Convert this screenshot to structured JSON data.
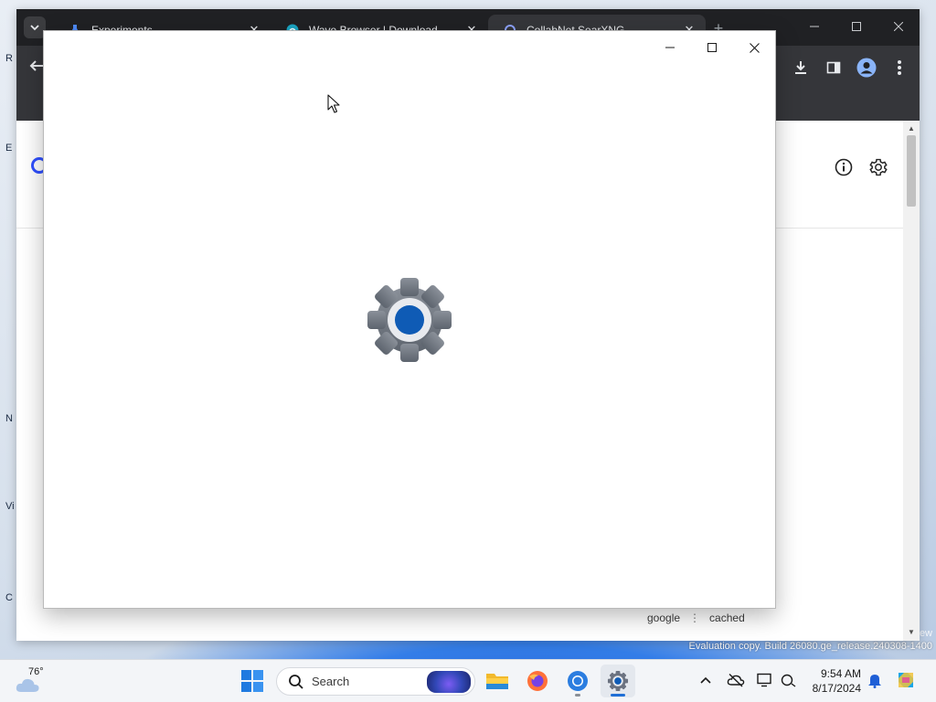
{
  "desktop": {
    "edge_letters": [
      "R",
      "E",
      "N",
      "Vi",
      "C"
    ],
    "watermark": "Evaluation copy. Build 26080.ge_release.240308-1400",
    "watermark_edge": "ew"
  },
  "browser": {
    "tabs": [
      {
        "title": "Experiments",
        "icon": "flask-icon",
        "active": false
      },
      {
        "title": "Wave Browser | Download",
        "icon": "wave-icon",
        "active": false
      },
      {
        "title": "CollabNet SearXNG",
        "icon": "searxng-icon",
        "active": true
      }
    ],
    "close_glyph": "✕",
    "new_tab_glyph": "+",
    "page": {
      "footer_links": [
        "google",
        "cached"
      ],
      "footer_separator": "⋮"
    }
  },
  "settings_window": {
    "app_icon": "settings-gear-icon",
    "accent": "#0067c0"
  },
  "taskbar": {
    "weather": {
      "temp": "76°",
      "icon": "cloud-icon"
    },
    "search_placeholder": "Search",
    "apps": [
      "start-icon",
      "file-explorer-icon",
      "firefox-icon",
      "chrome-icon",
      "settings-icon"
    ],
    "clock": {
      "time": "9:54 AM",
      "date": "8/17/2024"
    }
  },
  "colors": {
    "chrome_tabstrip": "#202124",
    "chrome_toolbar": "#35363a",
    "searxng_accent": "#3050ff",
    "taskbar_focus": "#1f6fd6"
  }
}
